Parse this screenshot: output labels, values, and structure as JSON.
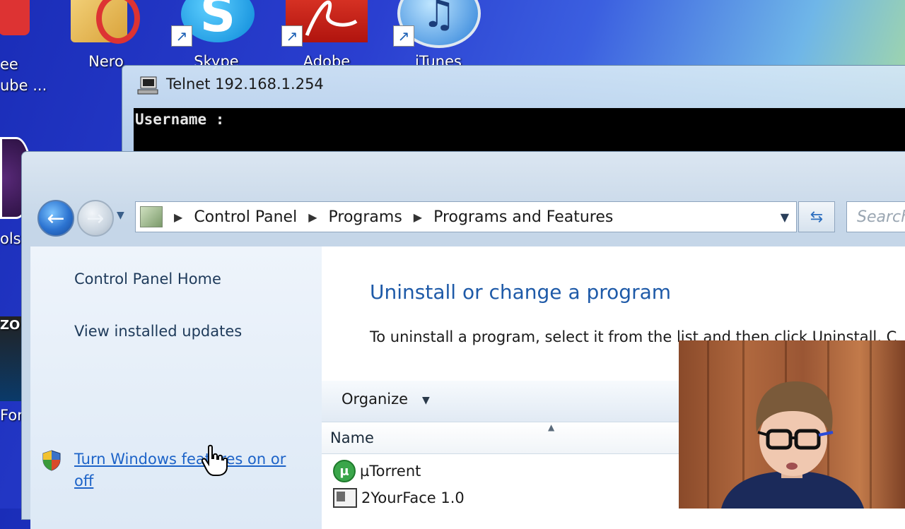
{
  "desktop": {
    "icons": [
      {
        "label": "ee\nube ...",
        "name": "free-youtube"
      },
      {
        "label": "Nero",
        "name": "nero"
      },
      {
        "label": "Skype",
        "name": "skype"
      },
      {
        "label": "Adobe",
        "name": "adobe"
      },
      {
        "label": "iTunes",
        "name": "itunes"
      }
    ],
    "left_labels": [
      "ols",
      "ZO",
      "For"
    ]
  },
  "telnet": {
    "title": "Telnet 192.168.1.254",
    "console_text": "Username :"
  },
  "explorer": {
    "breadcrumb": [
      "Control Panel",
      "Programs",
      "Programs and Features"
    ],
    "search_placeholder": "Search",
    "left_pane": {
      "home": "Control Panel Home",
      "updates": "View installed updates",
      "features": "Turn Windows features on or off"
    },
    "main": {
      "title": "Uninstall or change a program",
      "description": "To uninstall a program, select it from the list and then click Uninstall, C",
      "organize": "Organize",
      "column_name": "Name",
      "programs": [
        "µTorrent",
        "2YourFace 1.0"
      ]
    }
  },
  "colors": {
    "link": "#1d63c8",
    "title_blue": "#1e5aa8"
  }
}
